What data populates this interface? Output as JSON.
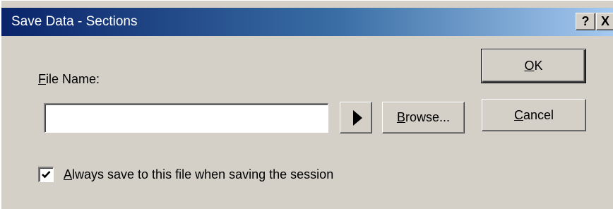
{
  "window": {
    "title": "Save Data - Sections",
    "help_glyph": "?",
    "close_glyph": "X",
    "titlebar_colors": [
      "#0a246a",
      "#a6caf0"
    ]
  },
  "form": {
    "file_name_mnemonic": "F",
    "file_name_rest": "ile Name:",
    "file_name_value": "",
    "browse_mnemonic": "B",
    "browse_rest": "rowse...",
    "expand_icon": "right-arrow-icon"
  },
  "buttons": {
    "ok_mnemonic": "O",
    "ok_rest": "K",
    "cancel_mnemonic": "C",
    "cancel_rest": "ancel"
  },
  "options": {
    "always_save_checked": true,
    "always_save_mnemonic": "A",
    "always_save_rest": "lways save to this file when saving the session"
  }
}
